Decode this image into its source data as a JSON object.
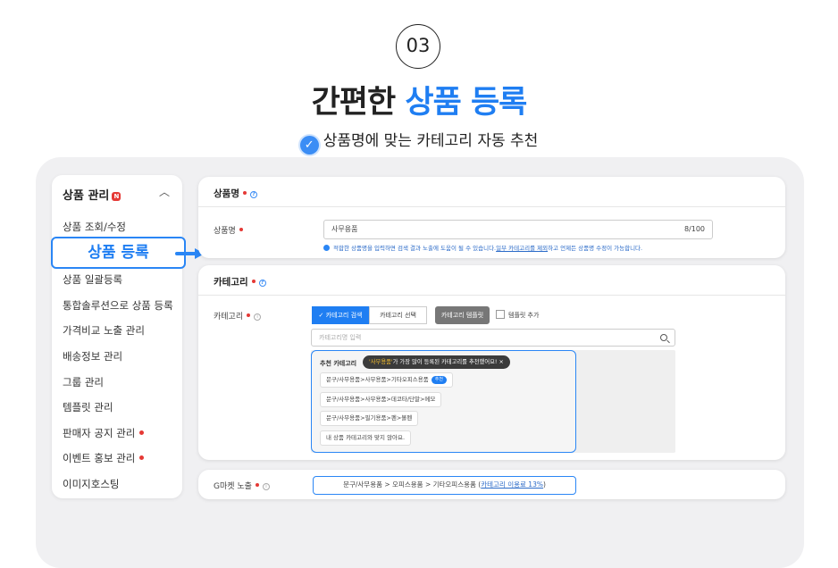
{
  "step_number": "03",
  "hero": {
    "title_part1": "간편한 ",
    "title_highlight": "상품 등록",
    "subtitle": "상품명에 맞는 카테고리 자동 추천"
  },
  "sidebar": {
    "title": "상품 관리",
    "badge": "N",
    "items": [
      {
        "label": "상품 조회/수정"
      },
      {
        "label": "상품 등록"
      },
      {
        "label": "상품 일괄등록"
      },
      {
        "label": "통합솔루션으로 상품 등록"
      },
      {
        "label": "가격비교 노출 관리"
      },
      {
        "label": "배송정보 관리"
      },
      {
        "label": "그룹 관리"
      },
      {
        "label": "템플릿 관리"
      },
      {
        "label": "판매자 공지 관리"
      },
      {
        "label": "이벤트 홍보 관리"
      },
      {
        "label": "이미지호스팅"
      }
    ]
  },
  "product_name_card": {
    "header": "상품명",
    "field_label": "상품명",
    "value": "사무용품",
    "count": "8/100",
    "helper_prefix": "적합한 상품명을 입력하면 검색 결과 노출에 도움이 될 수 있습니다.",
    "helper_link": "일부 카테고리를 제외",
    "helper_suffix": "하고 언제든 상품명 수정이 가능합니다."
  },
  "category_card": {
    "header": "카테고리",
    "field_label": "카테고리",
    "tabs": [
      "✓ 카테고리 검색",
      "카테고리 선택"
    ],
    "template_button": "카테고리 템플릿",
    "checkbox_label": "템플릿 추가",
    "search_placeholder": "카테고리명 입력",
    "recommend": {
      "title": "추천 카테고리",
      "tooltip_keyword": "'사무용품'",
      "tooltip_text": "가 가장 많이 등록된 카테고리를 추천했어요!",
      "tooltip_close": "×",
      "chips": [
        "문구/사무용품>사무용품>기타오피스용품",
        "문구/사무용품>사무용품>데코타/단말>메모",
        "문구/사무용품>필기용품>펜>볼펜",
        "내 상품 카테고리와 맞지 않아요."
      ],
      "chip_tag": "추천"
    }
  },
  "gmarket_card": {
    "label": "G마켓 노출",
    "path": "문구/사무용품 > 오피스용품 > 기타오피스용품",
    "rate_link": "카테고리 이용료 13%"
  },
  "colors": {
    "accent": "#1f7ef2",
    "required_dot": "#e53935",
    "panel_bg": "#f0f0f2"
  }
}
